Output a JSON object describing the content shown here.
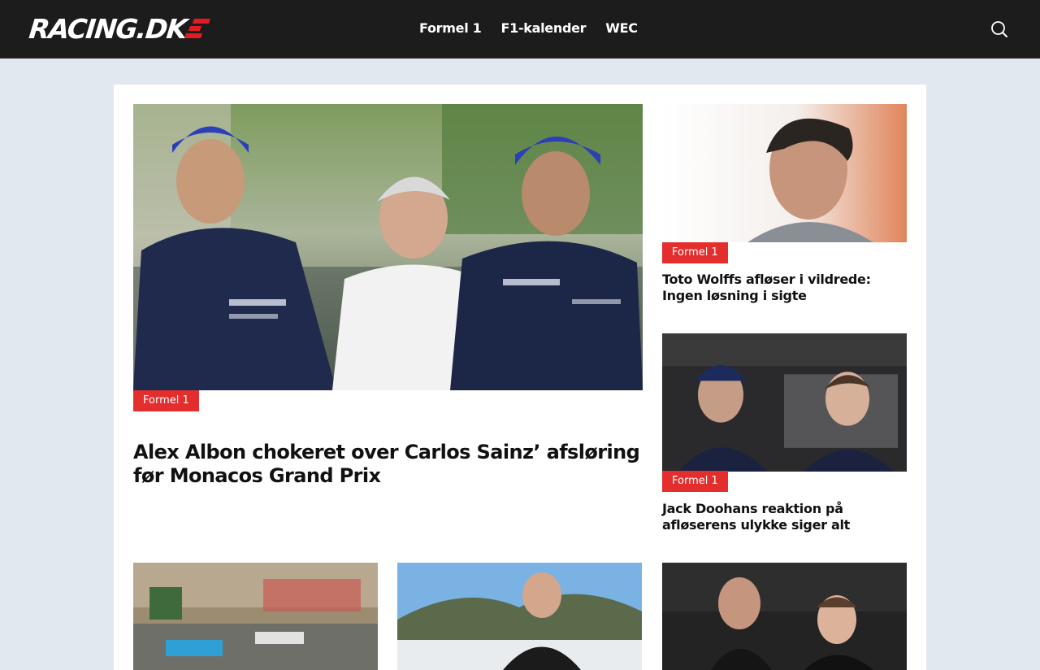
{
  "site": {
    "logo_text": "RACING.DK"
  },
  "nav": {
    "items": [
      "Formel 1",
      "F1-kalender",
      "WEC"
    ]
  },
  "icons": {
    "search": "search-icon"
  },
  "colors": {
    "header_bg": "#1c1c1c",
    "accent": "#e42d2d",
    "page_bg": "#e1e8f0"
  },
  "hero": {
    "category": "Formel 1",
    "title": "Alex Albon chokeret over Carlos Sainz’ afsløring før Monacos Grand Prix"
  },
  "side_articles": [
    {
      "category": "Formel 1",
      "title": "Toto Wolffs afløser i vildrede: Ingen løsning i sigte"
    },
    {
      "category": "Formel 1",
      "title": "Jack Doohans reaktion på afløserens ulykke siger alt"
    }
  ]
}
